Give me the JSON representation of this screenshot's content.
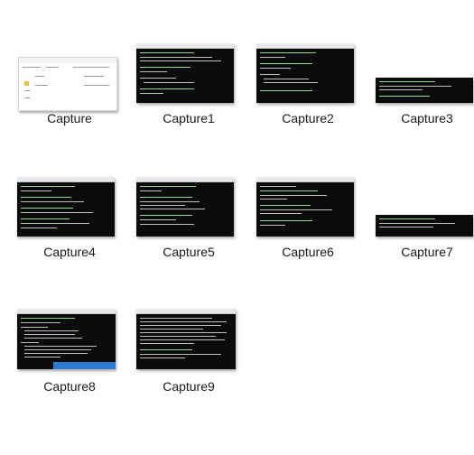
{
  "items": [
    {
      "name": "Capture",
      "thumb_type": "explorer"
    },
    {
      "name": "Capture1",
      "thumb_type": "terminal"
    },
    {
      "name": "Capture2",
      "thumb_type": "terminal"
    },
    {
      "name": "Capture3",
      "thumb_type": "terminal"
    },
    {
      "name": "Capture4",
      "thumb_type": "terminal"
    },
    {
      "name": "Capture5",
      "thumb_type": "terminal"
    },
    {
      "name": "Capture6",
      "thumb_type": "terminal"
    },
    {
      "name": "Capture7",
      "thumb_type": "terminal"
    },
    {
      "name": "Capture8",
      "thumb_type": "terminal"
    },
    {
      "name": "Capture9",
      "thumb_type": "terminal"
    }
  ],
  "colors": {
    "background": "#ffffff",
    "terminal_bg": "#0b0b0b",
    "label_text": "#1a1a1a",
    "selection_blue": "#2e7bd6"
  }
}
